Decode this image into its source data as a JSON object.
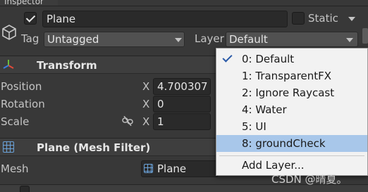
{
  "window": {
    "tab_title": "Inspector"
  },
  "header": {
    "active_checked": true,
    "object_name": "Plane",
    "static_checked": false,
    "static_label": "Static",
    "tag_label": "Tag",
    "tag_value": "Untagged",
    "layer_label": "Layer",
    "layer_value": "Default"
  },
  "transform": {
    "title": "Transform",
    "rows": [
      {
        "label": "Position",
        "axis": "X",
        "value": "4.700307"
      },
      {
        "label": "Rotation",
        "axis": "X",
        "value": "0"
      },
      {
        "label": "Scale",
        "axis": "X",
        "value": "1"
      }
    ]
  },
  "mesh_filter": {
    "title": "Plane (Mesh Filter)",
    "mesh_label": "Mesh",
    "mesh_value": "Plane"
  },
  "layer_menu": {
    "items": [
      {
        "label": "0: Default",
        "checked": true,
        "highlighted": false
      },
      {
        "label": "1: TransparentFX",
        "checked": false,
        "highlighted": false
      },
      {
        "label": "2: Ignore Raycast",
        "checked": false,
        "highlighted": false
      },
      {
        "label": "4: Water",
        "checked": false,
        "highlighted": false
      },
      {
        "label": "5: UI",
        "checked": false,
        "highlighted": false
      },
      {
        "label": "8: groundCheck",
        "checked": false,
        "highlighted": true
      }
    ],
    "add_layer": "Add Layer..."
  },
  "watermark": "CSDN @晴夏。",
  "colors": {
    "panel_bg": "#383838",
    "menu_bg": "#f2f2f2",
    "menu_highlight": "#a8c7ea",
    "check_color": "#2a5aa8",
    "icon_blue": "#6ba3da"
  }
}
